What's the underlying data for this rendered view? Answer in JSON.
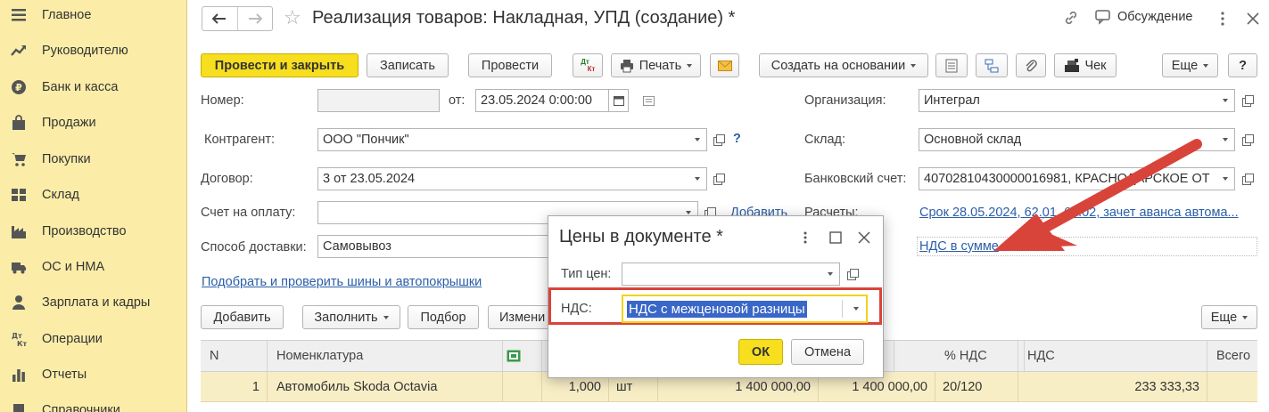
{
  "sidebar": {
    "items": [
      {
        "label": "Главное",
        "icon": "menu-icon"
      },
      {
        "label": "Руководителю",
        "icon": "trend-icon"
      },
      {
        "label": "Банк и касса",
        "icon": "ruble-icon"
      },
      {
        "label": "Продажи",
        "icon": "shopping-bag-icon"
      },
      {
        "label": "Покупки",
        "icon": "cart-icon"
      },
      {
        "label": "Склад",
        "icon": "warehouse-icon"
      },
      {
        "label": "Производство",
        "icon": "factory-icon"
      },
      {
        "label": "ОС и НМА",
        "icon": "truck-icon"
      },
      {
        "label": "Зарплата и кадры",
        "icon": "person-icon"
      },
      {
        "label": "Операции",
        "icon": "dt-kt-icon"
      },
      {
        "label": "Отчеты",
        "icon": "chart-icon"
      },
      {
        "label": "Справочники",
        "icon": "book-icon"
      }
    ]
  },
  "header": {
    "title": "Реализация товаров: Накладная, УПД (создание) *",
    "discuss_label": "Обсуждение"
  },
  "toolbar": {
    "post_close": "Провести и закрыть",
    "save": "Записать",
    "post": "Провести",
    "dtkt_top": "Дт",
    "dtkt_bottom": "Кт",
    "print": "Печать",
    "create_based": "Создать на основании",
    "check": "Чек",
    "more": "Еще",
    "help": "?"
  },
  "form": {
    "number_label": "Номер:",
    "number_value": "",
    "from_label": "от:",
    "date_value": "23.05.2024  0:00:00",
    "org_label": "Организация:",
    "org_value": "Интеграл",
    "counterparty_label": "Контрагент:",
    "counterparty_value": "ООО \"Пончик\"",
    "help_mark": "?",
    "warehouse_label": "Склад:",
    "warehouse_value": "Основной склад",
    "contract_label": "Договор:",
    "contract_value": "3 от 23.05.2024",
    "bank_label": "Банковский счет:",
    "bank_value": "40702810430000016981, КРАСНОДАРСКОЕ ОТ",
    "invoice_label": "Счет на оплату:",
    "invoice_value": "",
    "add_link": "Добавить",
    "settlements_label": "Расчеты:",
    "settlements_link": "Срок 28.05.2024, 62.01, 62.02, зачет аванса автома...",
    "delivery_label": "Способ доставки:",
    "delivery_value": "Самовывоз",
    "vat_link": "НДС в сумме",
    "tires_link": "Подобрать и проверить шины и автопокрышки"
  },
  "table_toolbar": {
    "add": "Добавить",
    "fill": "Заполнить",
    "select": "Подбор",
    "change": "Измени",
    "more": "Еще"
  },
  "table": {
    "headers": [
      "N",
      "Номенклатура",
      "",
      "К",
      "",
      "",
      "",
      "% НДС",
      "НДС",
      "Всего"
    ],
    "rows": [
      {
        "n": "1",
        "item": "Автомобиль Skoda Octavia",
        "qty": "1,000",
        "unit": "шт",
        "price": "1 400 000,00",
        "sum": "1 400 000,00",
        "vat_rate": "20/120",
        "vat": "233 333,33",
        "total": ""
      }
    ]
  },
  "dialog": {
    "title": "Цены в документе *",
    "price_type_label": "Тип цен:",
    "price_type_value": "",
    "vat_label": "НДС:",
    "vat_value": "НДС с межценовой разницы",
    "ok": "ОК",
    "cancel": "Отмена"
  },
  "colors": {
    "sidebar_bg": "#fbeda8",
    "primary_button": "#f7de1f",
    "selected_row": "#f8eec6",
    "link": "#2a5ea8",
    "annotation_red": "#d9443a",
    "selection_blue": "#3967c8"
  }
}
